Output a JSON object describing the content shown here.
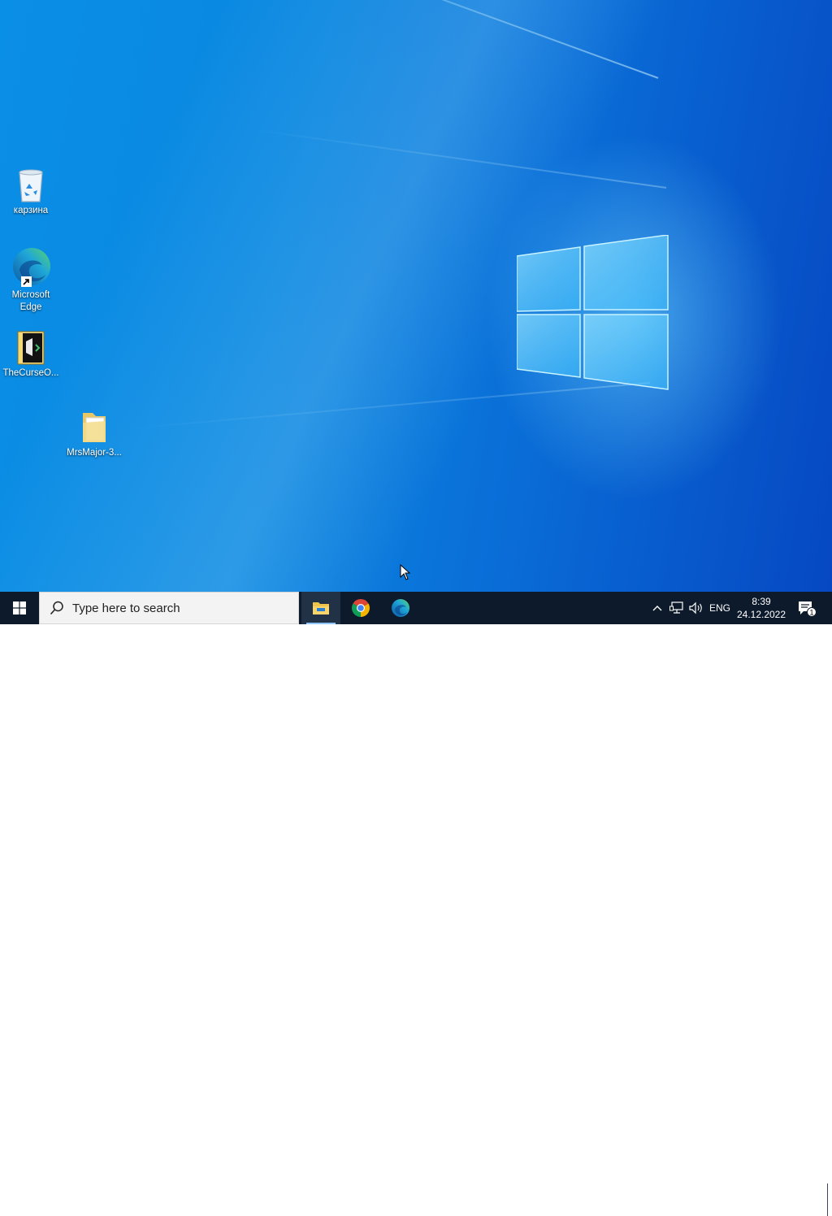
{
  "desktop": {
    "icons": [
      {
        "label": "карзина",
        "icon": "recycle-bin-icon"
      },
      {
        "label": "Microsoft Edge",
        "icon": "edge-icon",
        "shortcut": true
      },
      {
        "label": "TheCurseO...",
        "icon": "app-icon"
      },
      {
        "label": "MrsMajor-3...",
        "icon": "folder-icon"
      }
    ]
  },
  "taskbar": {
    "start": "start-icon",
    "search": {
      "placeholder": "Type here to search"
    },
    "apps": [
      {
        "name": "File Explorer",
        "icon": "folder-icon",
        "active": true
      },
      {
        "name": "Google Chrome",
        "icon": "chrome-icon"
      },
      {
        "name": "Microsoft Edge",
        "icon": "edge-icon"
      }
    ],
    "tray": {
      "language": "ENG",
      "time": "8:39",
      "date": "24.12.2022",
      "notifications_count": "1"
    }
  },
  "colors": {
    "taskbar": "#0c1a2b",
    "wallpaper_accent": "#0a86e0"
  }
}
